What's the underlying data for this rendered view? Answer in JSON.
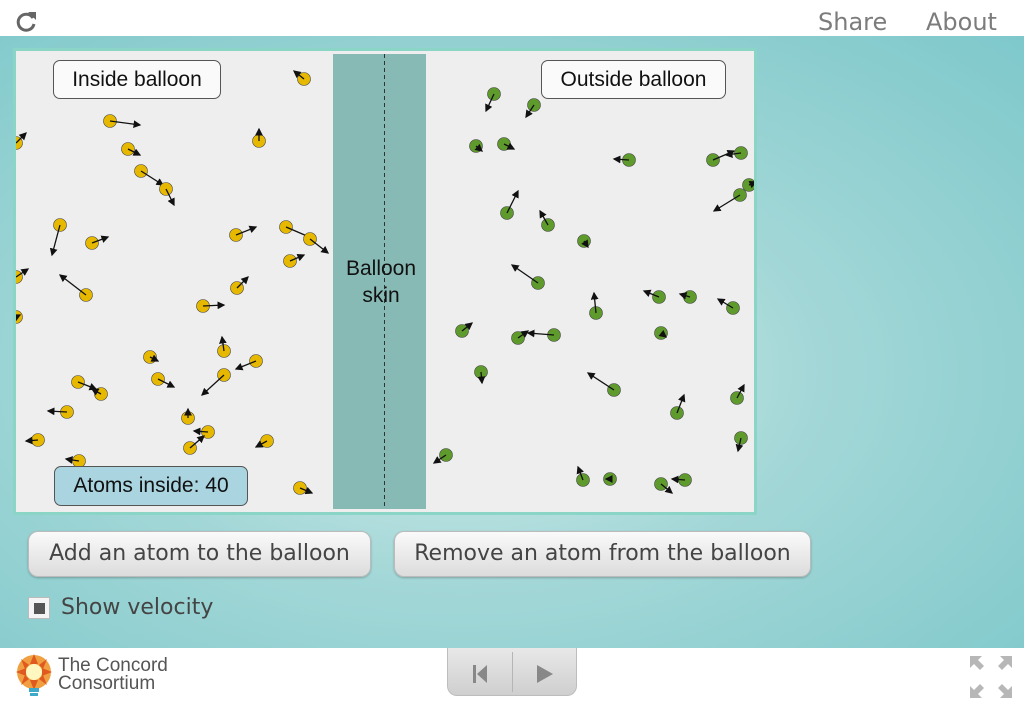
{
  "header": {
    "share_label": "Share",
    "about_label": "About"
  },
  "simulation": {
    "inside_label": "Inside balloon",
    "outside_label": "Outside balloon",
    "skin_label_line1": "Balloon",
    "skin_label_line2": "skin",
    "counter_text": "Atoms inside: 40",
    "inside_atom_color": "#e6b800",
    "outside_atom_color": "#5e9a2c",
    "skin_color": "#88bab5"
  },
  "controls": {
    "add_label": "Add an atom to the balloon",
    "remove_label": "Remove an atom from the balloon",
    "show_velocity_label": "Show velocity",
    "show_velocity_checked": true
  },
  "footer": {
    "logo_line1": "The Concord",
    "logo_line2": "Consortium"
  }
}
